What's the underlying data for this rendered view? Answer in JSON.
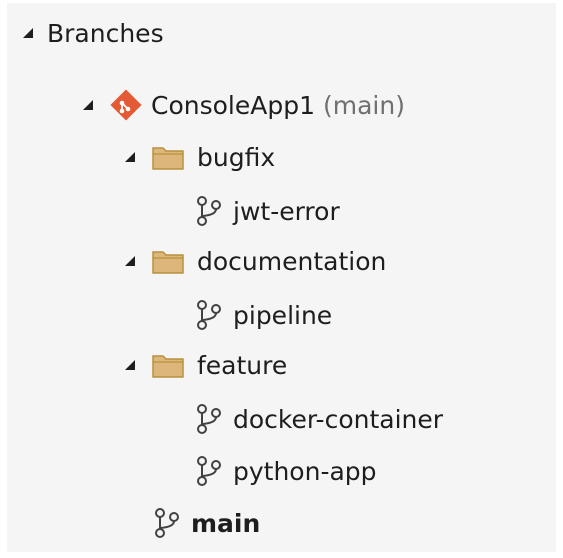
{
  "panel": {
    "section_title": "Branches",
    "repo": {
      "name": "ConsoleApp1",
      "current_branch": "(main)"
    },
    "folders": [
      {
        "name": "bugfix",
        "branches": [
          "jwt-error"
        ]
      },
      {
        "name": "documentation",
        "branches": [
          "pipeline"
        ]
      },
      {
        "name": "feature",
        "branches": [
          "docker-container",
          "python-app"
        ]
      }
    ],
    "root_branches": [
      "main"
    ]
  },
  "icons": {
    "expander": "expanded-triangle-icon",
    "repo": "git-repo-diamond-icon",
    "folder": "folder-icon",
    "branch": "git-branch-icon"
  },
  "colors": {
    "repo_icon": "#e35a34",
    "folder_fill": "#dcb67a",
    "folder_stroke": "#b8913e",
    "branch_icon": "#424242",
    "muted_text": "#707070",
    "panel_bg": "#f5f5f5"
  }
}
